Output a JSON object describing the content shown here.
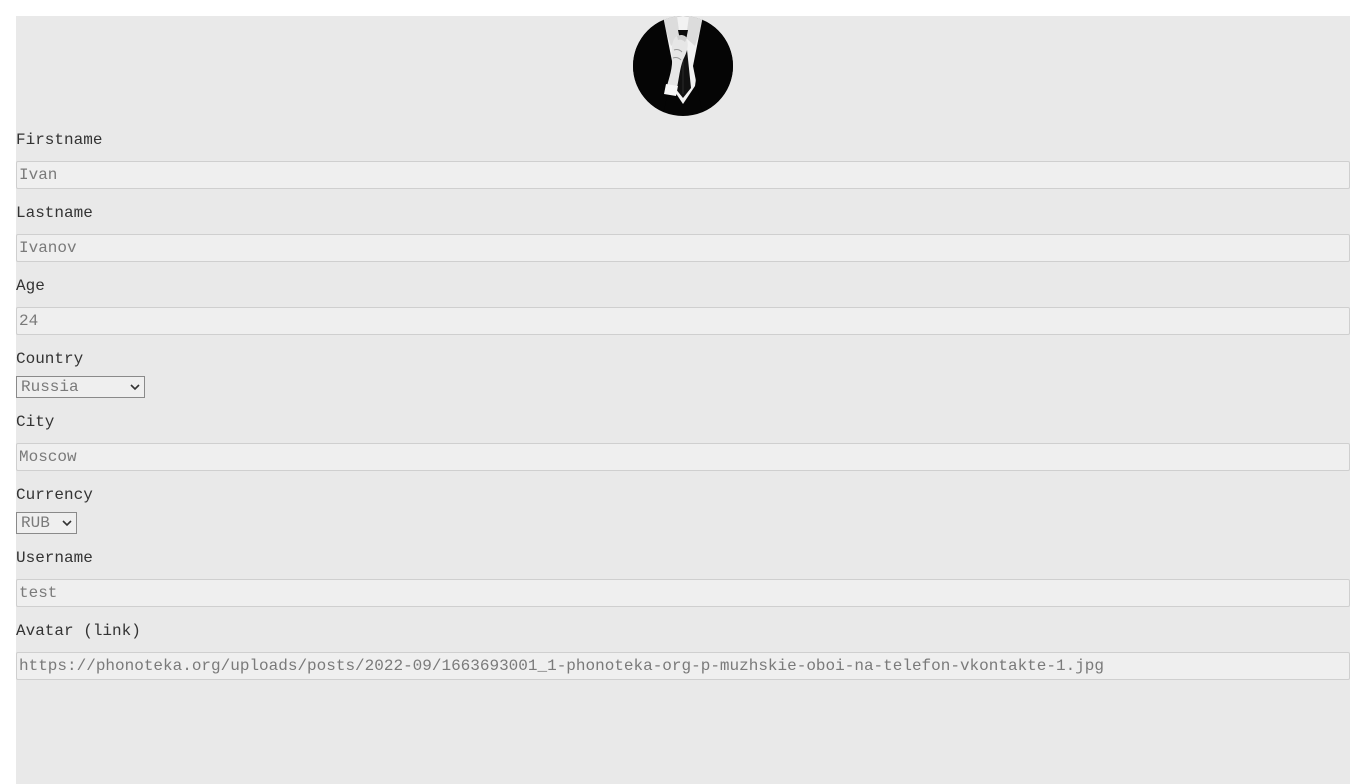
{
  "profile": {
    "avatar_icon": "suited-man-avatar-icon",
    "fields": {
      "firstname": {
        "label": "Firstname",
        "value": "Ivan"
      },
      "lastname": {
        "label": "Lastname",
        "value": "Ivanov"
      },
      "age": {
        "label": "Age",
        "value": "24"
      },
      "country": {
        "label": "Country",
        "value": "Russia"
      },
      "city": {
        "label": "City",
        "value": "Moscow"
      },
      "currency": {
        "label": "Currency",
        "value": "RUB"
      },
      "username": {
        "label": "Username",
        "value": "test"
      },
      "avatar_link": {
        "label": "Avatar (link)",
        "value": "https://phonoteka.org/uploads/posts/2022-09/1663693001_1-phonoteka-org-p-muzhskie-oboi-na-telefon-vkontakte-1.jpg"
      }
    }
  },
  "colors": {
    "panel_bg": "#e9e9e9",
    "input_bg": "#efefef",
    "label_text": "#333333",
    "input_text": "#7a7a7a"
  }
}
